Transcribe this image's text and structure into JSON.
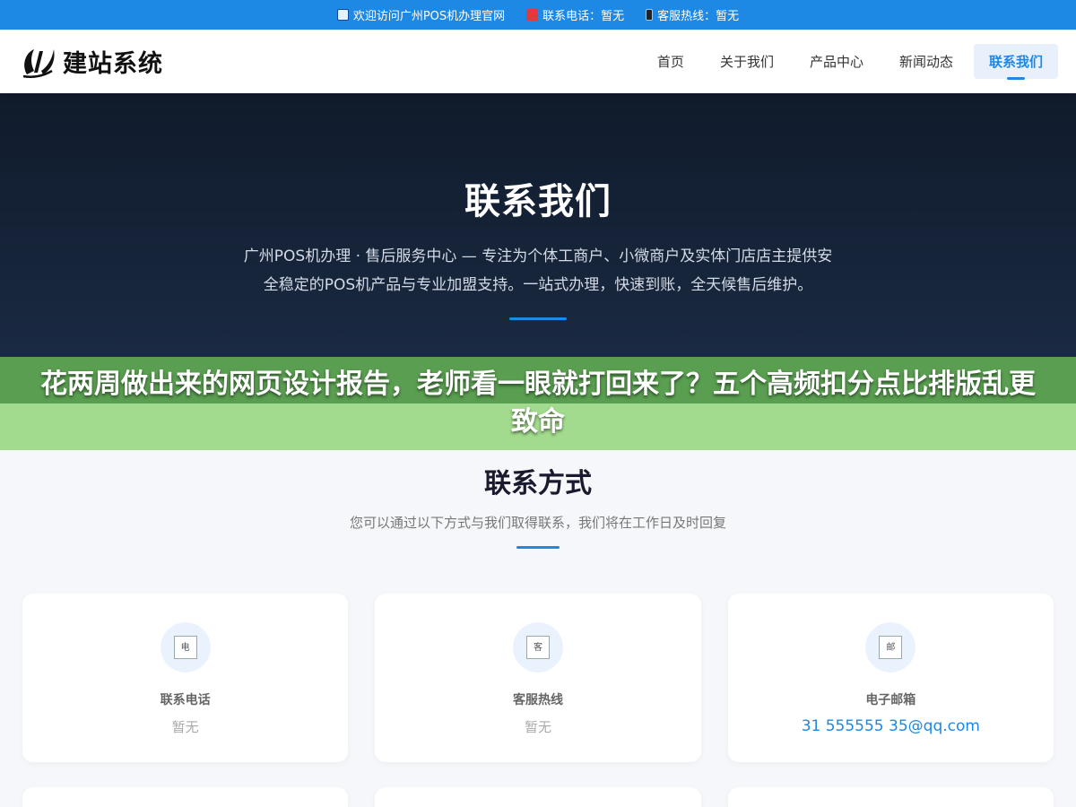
{
  "topbar": {
    "welcome": "欢迎访问广州POS机办理官网",
    "phone": "联系电话：暂无",
    "hotline": "客服热线：暂无"
  },
  "header": {
    "logo_text": "建站系统",
    "nav": [
      {
        "label": "首页"
      },
      {
        "label": "关于我们"
      },
      {
        "label": "产品中心"
      },
      {
        "label": "新闻动态"
      },
      {
        "label": "联系我们"
      }
    ],
    "active_index": 4
  },
  "hero": {
    "title": "联系我们",
    "description": "广州POS机办理 · 售后服务中心 — 专注为个体工商户、小微商户及实体门店店主提供安全稳定的POS机产品与专业加盟支持。一站式办理，快速到账，全天候售后维护。"
  },
  "banner": {
    "text": "花两周做出来的网页设计报告，老师看一眼就打回来了？五个高频扣分点比排版乱更致命"
  },
  "contact": {
    "title": "联系方式",
    "subtitle": "您可以通过以下方式与我们取得联系，我们将在工作日及时回复",
    "cards": [
      {
        "icon_alt": "电",
        "label": "联系电话",
        "value": "暂无"
      },
      {
        "icon_alt": "客",
        "label": "客服热线",
        "value": "暂无"
      },
      {
        "icon_alt": "邮",
        "label": "电子邮箱",
        "value": "31 555555 35@qq.com"
      }
    ]
  },
  "colors": {
    "accent": "#1e88e5",
    "hero_bg": "#101a2b",
    "banner_dark": "#5a9e51",
    "banner_light": "#a3db8e"
  }
}
